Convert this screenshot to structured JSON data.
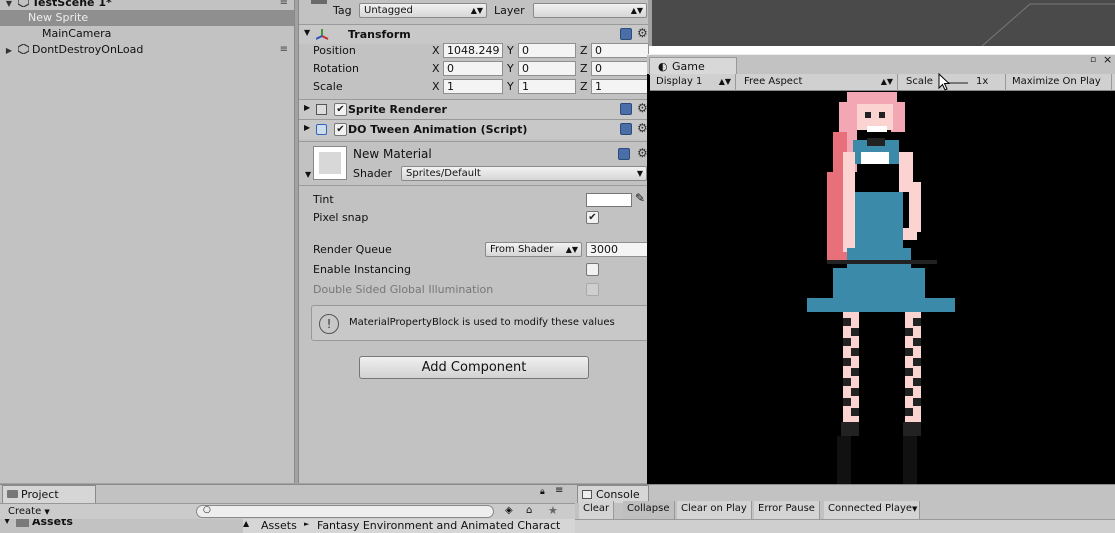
{
  "hierarchy": {
    "items": [
      {
        "label": "TestScene 1*",
        "arrow": "▼"
      },
      {
        "label": "New Sprite",
        "arrow": ""
      },
      {
        "label": "MainCamera",
        "arrow": ""
      },
      {
        "label": "DontDestroyOnLoad",
        "arrow": "▶"
      }
    ]
  },
  "inspector": {
    "tag_label": "Tag",
    "tag_value": "Untagged",
    "layer_label": "Layer",
    "layer_value": "",
    "transform": {
      "title": "Transform",
      "rows": [
        {
          "label": "Position",
          "x": "1048.249",
          "y": "0",
          "z": "0"
        },
        {
          "label": "Rotation",
          "x": "0",
          "y": "0",
          "z": "0"
        },
        {
          "label": "Scale",
          "x": "1",
          "y": "1",
          "z": "1"
        }
      ],
      "axis_x": "X",
      "axis_y": "Y",
      "axis_z": "Z"
    },
    "sprite_renderer": "Sprite Renderer",
    "dotween": "DO Tween Animation (Script)",
    "material": {
      "name": "New Material",
      "shader_label": "Shader",
      "shader_value": "Sprites/Default",
      "tint_label": "Tint",
      "pixel_snap_label": "Pixel snap",
      "render_queue_label": "Render Queue",
      "render_queue_mode": "From Shader",
      "render_queue_value": "3000",
      "instancing_label": "Enable Instancing",
      "dsgi_label": "Double Sided Global Illumination",
      "info": "MaterialPropertyBlock is used to modify these values"
    },
    "add_component": "Add Component"
  },
  "game": {
    "tab": "Game",
    "display": "Display 1",
    "aspect": "Free Aspect",
    "scale_label": "Scale",
    "scale_value": "1x",
    "maximize": "Maximize On Play"
  },
  "project": {
    "tab": "Project",
    "create": "Create",
    "search_placeholder": "",
    "assets_label": "Assets",
    "breadcrumb_root": "Assets",
    "breadcrumb_sep": "►",
    "breadcrumb_folder": "Fantasy Environment and Animated Charact"
  },
  "console": {
    "tab": "Console",
    "clear": "Clear",
    "collapse": "Collapse",
    "clear_on_play": "Clear on Play",
    "error_pause": "Error Pause",
    "connected": "Connected Playe"
  },
  "colors": {
    "panel": "#c2c2c2",
    "selection": "#8f8f8f",
    "game_bg": "#000000",
    "hair": "#f3a7b5",
    "dress": "#3b8aaa",
    "skin": "#fbd3d0"
  }
}
